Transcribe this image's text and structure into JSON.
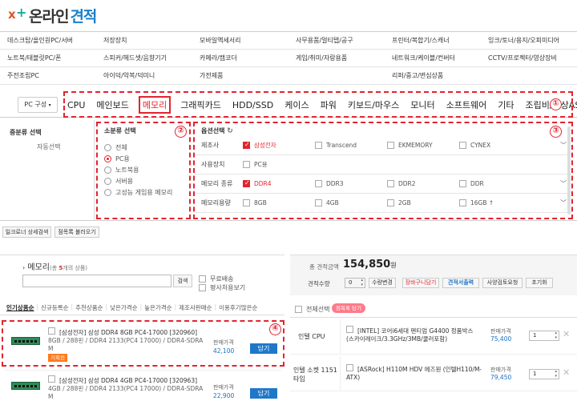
{
  "header": {
    "logo_part1": "온라인",
    "logo_part2": "견적"
  },
  "categories": [
    [
      "데스크탑/올인원PC/서버",
      "저장장치",
      "모바일액세서리",
      "사무용품/멀티탭/공구",
      "프린터/복합기/스캐너",
      "잉크/토너/용지/오피미디어"
    ],
    [
      "노트북/태블릿PC/폰",
      "스피커/헤드셋/음향기기",
      "카메라/캠코더",
      "게임/취미/자랑용품",
      "네트워크/케이블/컨버터",
      "CCTV/프로젝터/영상장비"
    ],
    [
      "주전조립PC",
      "아이덕/악복/덕미니",
      "가전제품",
      "",
      "리퍼/중고/변심상품",
      ""
    ]
  ],
  "pc_tabs": {
    "label": "PC 구성",
    "items": [
      "CPU",
      "메인보드",
      "메모리",
      "그래픽카드",
      "HDD/SSD",
      "케이스",
      "파워",
      "키보드/마우스",
      "모니터",
      "소프트웨어",
      "기타",
      "조립비/유상AS"
    ],
    "active_index": 2
  },
  "badges": [
    "①",
    "②",
    "③",
    "④"
  ],
  "filters": {
    "col1_title": "중분류 선택",
    "col1_value": "자동선택",
    "col2_title": "소분류 선택",
    "col2_options": [
      "전체",
      "PC용",
      "노트북용",
      "서버용",
      "고성능 게임용 메모리"
    ],
    "col2_selected": 1,
    "col3_title": "옵션선택",
    "spec_rows": [
      {
        "label": "제조사",
        "values": [
          "삼성전자",
          "Transcend",
          "EKMEMORY",
          "CYNEX"
        ],
        "checked": [
          true,
          false,
          false,
          false
        ]
      },
      {
        "label": "사용장치",
        "values": [
          "PC용"
        ],
        "checked": [
          false
        ]
      },
      {
        "label": "메모리 종류",
        "values": [
          "DDR4",
          "DDR3",
          "DDR2",
          "DDR"
        ],
        "checked": [
          true,
          false,
          false,
          false
        ]
      },
      {
        "label": "메모리용량",
        "values": [
          "8GB",
          "4GB",
          "2GB",
          "16GB ↑"
        ],
        "checked": [
          false,
          false,
          false,
          false
        ]
      }
    ]
  },
  "under_filter_buttons": [
    "일크로너 상세검색",
    "점목록 불러오기"
  ],
  "search": {
    "title": "메모리",
    "count_prefix": "(총 ",
    "count": "5",
    "count_suffix": "개의 상품)",
    "search_button": "검색",
    "opt_free_shipping": "무료배송",
    "opt_price_view": "평사처용보기"
  },
  "list_tabs": [
    "인기상품순",
    "신규등록순",
    "추천상품순",
    "낮은가격순",
    "높은가격순",
    "제조사판매순",
    "이용후기많은순"
  ],
  "products": [
    {
      "title": "[삼성전자] 삼성 DDR4 8GB PC4-17000 [320960]",
      "spec": "8GB / 288핀 / DDR4 2133(PC4 17000) / DDR4-SDRA",
      "spec2": "M",
      "tag": "기획전",
      "price_label": "판매가격",
      "price": "42,100",
      "button": "담기"
    },
    {
      "title": "[삼성전자] 삼성 DDR4 4GB PC4-17000 [320963]",
      "spec": "4GB / 288핀 / DDR4 2133(PC4 17000) / DDR4-SDRA",
      "spec2": "M",
      "price_label": "판매가격",
      "price": "22,900",
      "button": "담기"
    }
  ],
  "estimate": {
    "total_label": "총 견적금액",
    "total_value": "154,850",
    "total_unit": "원",
    "qty_label": "견적수량",
    "qty_value": "0",
    "buttons": [
      "수량변경",
      "장바구니담기",
      "견적서출력",
      "사양검토요청",
      "초기화"
    ],
    "select_all": "전체선택",
    "delete_selected": "점목록 담기",
    "items": [
      {
        "category": "인텔 CPU",
        "name": "[INTEL] 코어i6세대 펜티엄 G4400 정품박스 (스카이레이크/3.3GHz/3MB/쿨러포함)",
        "price_label": "판매가격",
        "price": "75,400",
        "qty": "1"
      },
      {
        "category": "인텔 소켓 1151 타입",
        "name": "[ASRock] H110M HDV 에즈원 (인텔H110/M-ATX)",
        "price_label": "판매가격",
        "price": "79,450",
        "qty": "1"
      }
    ]
  },
  "colors": {
    "accent_red": "#e2242f",
    "brand_blue": "#1a7fc7",
    "button_blue": "#1f77c9"
  }
}
